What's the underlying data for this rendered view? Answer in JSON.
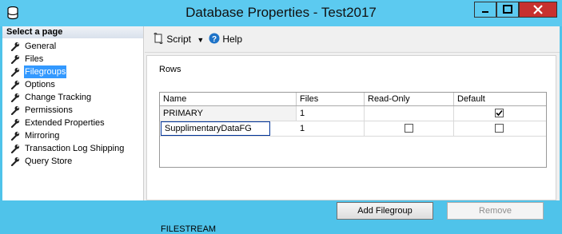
{
  "window": {
    "title": "Database Properties - Test2017",
    "controls": [
      "minimize",
      "maximize",
      "close"
    ]
  },
  "left_pane": {
    "header": "Select a page",
    "items": [
      {
        "label": "General",
        "icon": "wrench-icon",
        "active": false
      },
      {
        "label": "Files",
        "icon": "wrench-icon",
        "active": false
      },
      {
        "label": "Filegroups",
        "icon": "wrench-icon",
        "active": true
      },
      {
        "label": "Options",
        "icon": "wrench-icon",
        "active": false
      },
      {
        "label": "Change Tracking",
        "icon": "wrench-icon",
        "active": false
      },
      {
        "label": "Permissions",
        "icon": "wrench-icon",
        "active": false
      },
      {
        "label": "Extended Properties",
        "icon": "wrench-icon",
        "active": false
      },
      {
        "label": "Mirroring",
        "icon": "wrench-icon",
        "active": false
      },
      {
        "label": "Transaction Log Shipping",
        "icon": "wrench-icon",
        "active": false
      },
      {
        "label": "Query Store",
        "icon": "wrench-icon",
        "active": false
      }
    ]
  },
  "toolbar": {
    "script_label": "Script",
    "help_label": "Help"
  },
  "rows_section": {
    "label": "Rows",
    "columns": [
      "Name",
      "Files",
      "Read-Only",
      "Default"
    ],
    "rows": [
      {
        "name": "PRIMARY",
        "files": "1",
        "read_only": null,
        "default": true
      },
      {
        "name": "SupplimentaryDataFG",
        "files": "1",
        "read_only": false,
        "default": false
      }
    ]
  },
  "buttons": {
    "add_filegroup": "Add Filegroup",
    "remove": "Remove"
  },
  "filestream_label": "FILESTREAM",
  "colors": {
    "title_bar": "#5ccaf0",
    "selection": "#3399ff",
    "close_button": "#c7312f"
  }
}
